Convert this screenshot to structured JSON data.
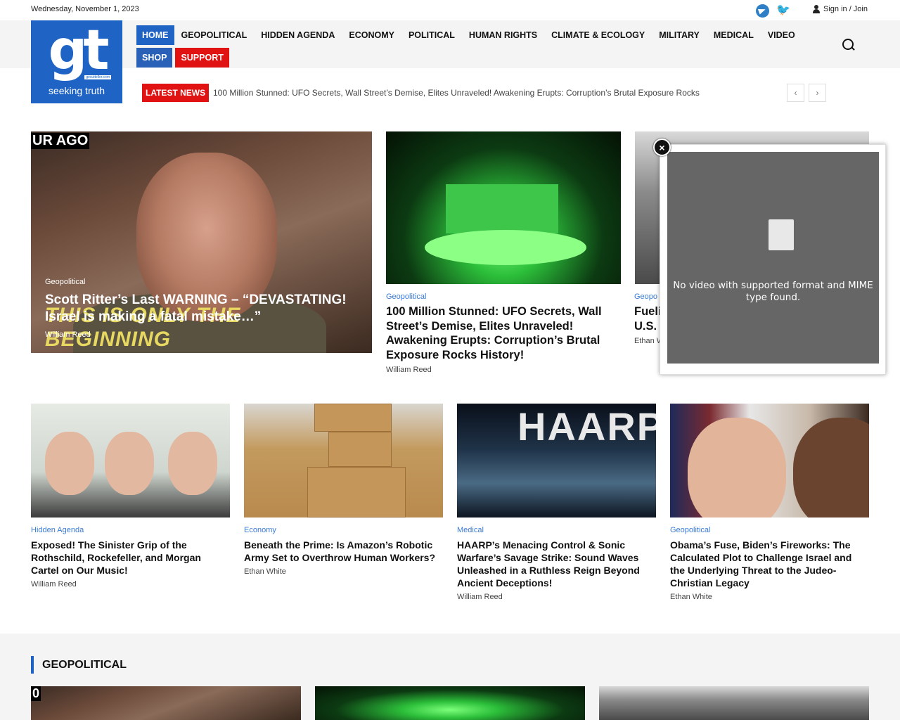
{
  "topbar": {
    "date": "Wednesday, November 1, 2023",
    "signin": "Sign in / Join"
  },
  "logo": {
    "mark": "gt",
    "domain": "gesutteller.com",
    "tagline": "seeking truth"
  },
  "nav": {
    "items": [
      "HOME",
      "GEOPOLITICAL",
      "HIDDEN AGENDA",
      "ECONOMY",
      "POLITICAL",
      "HUMAN RIGHTS",
      "CLIMATE & ECOLOGY",
      "MILITARY",
      "MEDICAL",
      "VIDEO"
    ],
    "shop": "SHOP",
    "support": "SUPPORT"
  },
  "ticker": {
    "label": "LATEST NEWS",
    "text": "100 Million Stunned: UFO Secrets, Wall Street’s Demise, Elites Unraveled! Awakening Erupts: Corruption’s Brutal Exposure Rocks",
    "prev": "‹",
    "next": "›"
  },
  "featured": [
    {
      "category": "Geopolitical",
      "title": "Scott Ritter’s Last WARNING – “DEVASTATING! Israel is making a fatal mistake…”",
      "author": "William Reed",
      "image_text_top": "UR AGO",
      "image_text_bottom": "THIS IS ONLY THE BEGINNING"
    },
    {
      "category": "Geopolitical",
      "title": "100 Million Stunned: UFO Secrets, Wall Street’s Demise, Elites Unraveled! Awakening Erupts: Corruption’s Brutal Exposure Rocks History!",
      "author": "William Reed"
    },
    {
      "category": "Geopo",
      "title": "Fueli U.S.",
      "author": "Ethan W"
    }
  ],
  "articles": [
    {
      "category": "Hidden Agenda",
      "title": "Exposed! The Sinister Grip of the Rothschild, Rockefeller, and Morgan Cartel on Our Music!",
      "author": "William Reed"
    },
    {
      "category": "Economy",
      "title": "Beneath the Prime: Is Amazon’s Robotic Army Set to Overthrow Human Workers?",
      "author": "Ethan White"
    },
    {
      "category": "Medical",
      "title": "HAARP’s Menacing Control & Sonic Warfare’s Savage Strike: Sound Waves Unleashed in a Ruthless Reign Beyond Ancient Deceptions!",
      "author": "William Reed",
      "image_text": "HAARP"
    },
    {
      "category": "Geopolitical",
      "title": "Obama’s Fuse, Biden’s Fireworks: The Calculated Plot to Challenge Israel and the Underlying Threat to the Judeo-Christian Legacy",
      "author": "Ethan White"
    }
  ],
  "popup": {
    "close": "×",
    "message": "No video with supported format and MIME type found."
  },
  "section": {
    "title": "GEOPOLITICAL",
    "thumb_text": "0"
  },
  "colors": {
    "brand": "#1f63c4",
    "support": "#e01212",
    "category": "#3a7bd5"
  }
}
